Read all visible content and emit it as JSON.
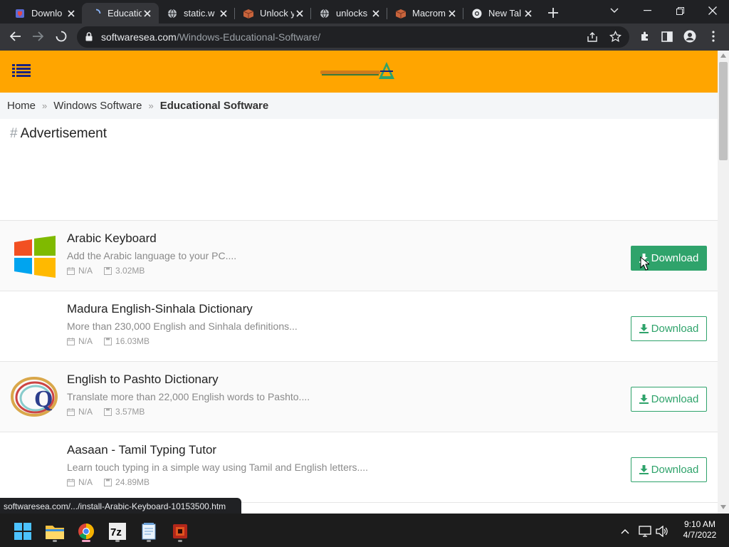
{
  "tabs": [
    {
      "title": "Downlo",
      "icon": "shield-favicon"
    },
    {
      "title": "Educatio",
      "icon": "loading-favicon",
      "active": true
    },
    {
      "title": "static.w",
      "icon": "globe-favicon"
    },
    {
      "title": "Unlock y",
      "icon": "box-favicon"
    },
    {
      "title": "unlocks",
      "icon": "globe-favicon"
    },
    {
      "title": "Macrom",
      "icon": "box-favicon"
    },
    {
      "title": "New Tal",
      "icon": "chrome-favicon"
    }
  ],
  "omnibox": {
    "host": "softwaresea.com",
    "path": "/Windows-Educational-Software/"
  },
  "breadcrumb": {
    "home": "Home",
    "category": "Windows Software",
    "current": "Educational Software"
  },
  "ad": {
    "hash": "#",
    "label": "Advertisement"
  },
  "apps": [
    {
      "name": "Arabic Keyboard",
      "desc": "Add the Arabic language to your PC....",
      "date": "N/A",
      "size": "3.02MB",
      "download": "Download",
      "icon": "windows-logo-icon"
    },
    {
      "name": "Madura English-Sinhala Dictionary",
      "desc": "More than 230,000 English and Sinhala definitions...",
      "date": "N/A",
      "size": "16.03MB",
      "download": "Download",
      "icon": "blank-app-icon"
    },
    {
      "name": "English to Pashto Dictionary",
      "desc": "Translate more than 22,000 English words to Pashto....",
      "date": "N/A",
      "size": "3.57MB",
      "download": "Download",
      "icon": "q-swirl-logo-icon"
    },
    {
      "name": "Aasaan - Tamil Typing Tutor",
      "desc": "Learn touch typing in a simple way using Tamil and English letters....",
      "date": "N/A",
      "size": "24.89MB",
      "download": "Download",
      "icon": "blank-app-icon"
    }
  ],
  "status_url": "softwaresea.com/.../install-Arabic-Keyboard-10153500.htm",
  "clock": {
    "time": "9:10 AM",
    "date": "4/7/2022"
  },
  "colors": {
    "header": "#ffa500",
    "download_green": "#2fa36b",
    "tab_bar": "#202124",
    "toolbar": "#35363a",
    "taskbar": "#1c1c1c"
  }
}
